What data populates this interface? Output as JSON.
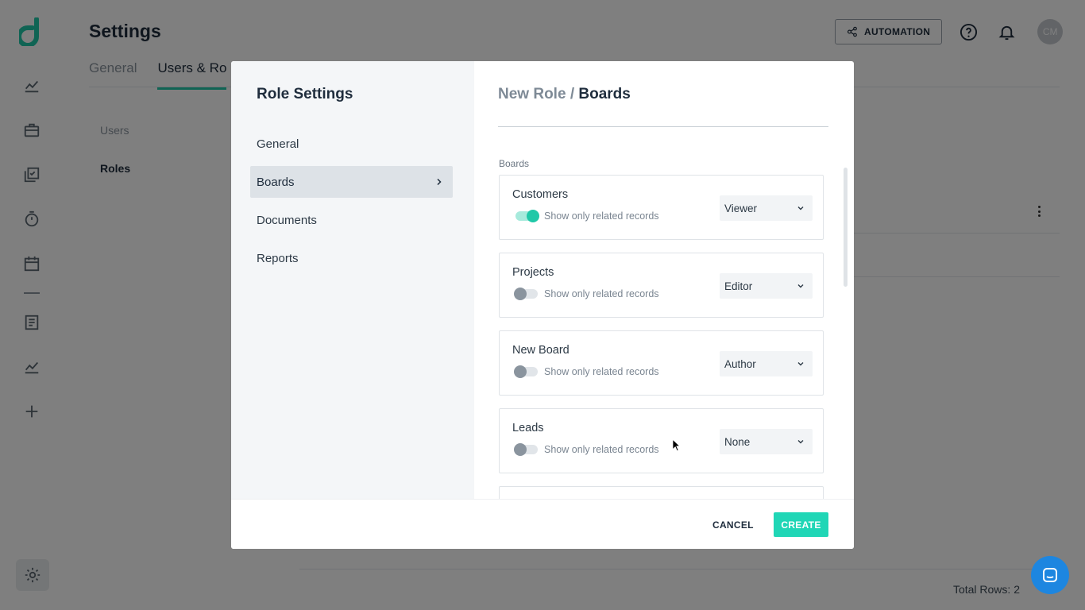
{
  "app": {
    "page_title": "Settings",
    "tabs": [
      "General",
      "Users & Ro"
    ],
    "sub_nav": [
      "Users",
      "Roles"
    ],
    "automation_label": "AUTOMATION",
    "avatar_initials": "CM",
    "total_rows": "Total Rows: 2",
    "accent_color": "#20c8a8"
  },
  "modal": {
    "left_title": "Role Settings",
    "nav": [
      {
        "label": "General"
      },
      {
        "label": "Boards"
      },
      {
        "label": "Documents"
      },
      {
        "label": "Reports"
      }
    ],
    "breadcrumb": {
      "parent": "New Role",
      "separator": "/",
      "current": "Boards"
    },
    "section_label": "Boards",
    "boards": [
      {
        "name": "Customers",
        "toggle_label": "Show only related records",
        "toggle_on": true,
        "role": "Viewer"
      },
      {
        "name": "Projects",
        "toggle_label": "Show only related records",
        "toggle_on": false,
        "role": "Editor"
      },
      {
        "name": "New Board",
        "toggle_label": "Show only related records",
        "toggle_on": false,
        "role": "Author"
      },
      {
        "name": "Leads",
        "toggle_label": "Show only related records",
        "toggle_on": false,
        "role": "None"
      }
    ],
    "cancel_label": "CANCEL",
    "create_label": "CREATE",
    "create_color": "#20d6b6"
  }
}
